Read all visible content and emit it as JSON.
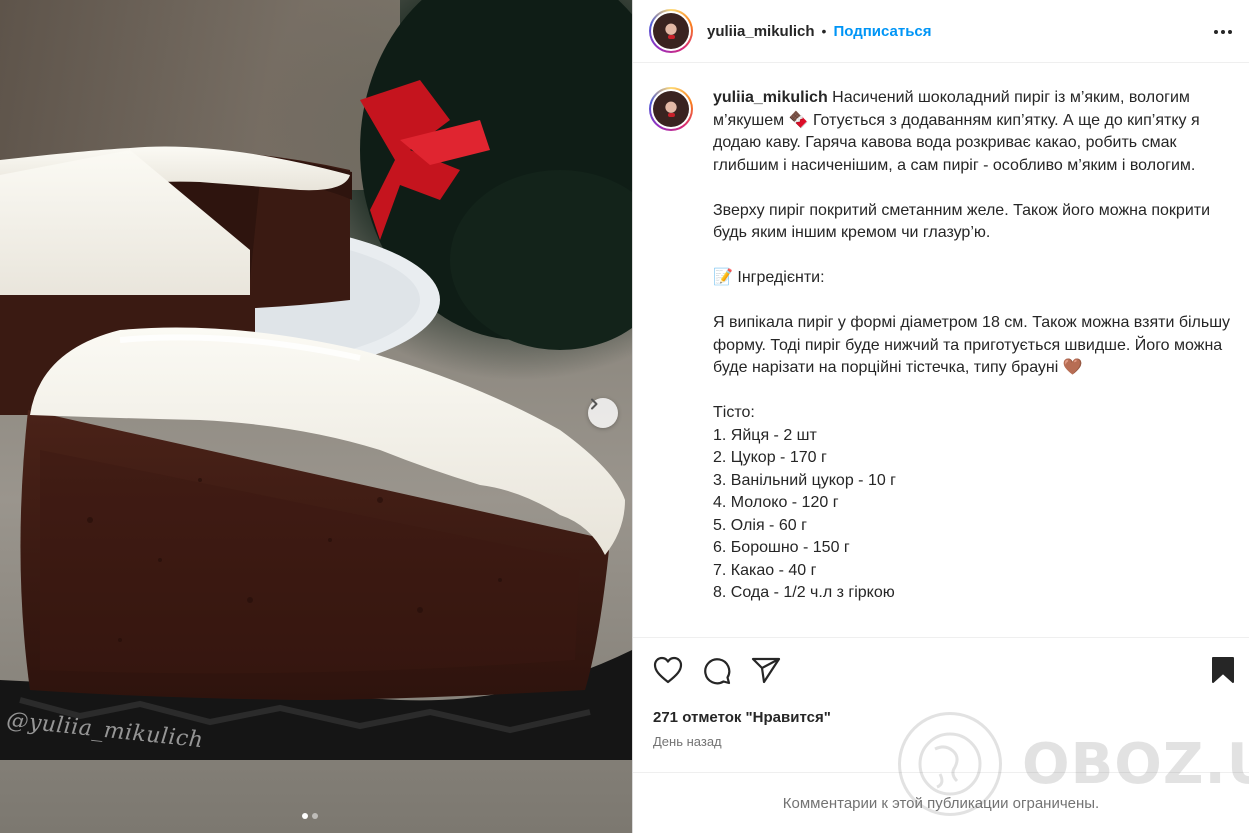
{
  "header": {
    "username": "yuliia_mikulich",
    "separator": "•",
    "follow_label": "Подписаться",
    "more_icon": "more-horizontal-icon"
  },
  "media": {
    "watermark": "@yuliia_mikulich",
    "next_icon": "chevron-right-icon",
    "slides_total": 2,
    "slide_current": 1
  },
  "caption": {
    "username": "yuliia_mikulich",
    "lines": [
      "Насичений шоколадний пиріг із м’яким, вологим м’якушем 🍫 Готується з додаванням кип’ятку. А ще до кип’ятку я додаю каву. Гаряча кавова вода розкриває какао, робить смак глибшим і насиченішим, а сам пиріг - особливо м’яким і вологим.",
      "",
      "Зверху пиріг покритий сметанним желе. Також його можна покрити будь яким іншим кремом чи глазур’ю.",
      "",
      "📝 Інгредієнти:",
      "",
      "Я випікала пиріг у формі діаметром 18 см. Також можна взяти більшу форму. Тоді пиріг буде нижчий та приготується швидше. Його можна буде нарізати на порційні тістечка, типу брауні 🤎",
      "",
      "Тісто:",
      "1. Яйця - 2 шт",
      "2. Цукор - 170 г",
      "3. Ванільний цукор - 10 г",
      "4. Молоко - 120 г",
      "5. Олія - 60 г",
      "6. Борошно - 150 г",
      "7. Какао - 40 г",
      "8. Сода - 1/2 ч.л з гіркою"
    ]
  },
  "actions": {
    "like_icon": "heart-icon",
    "comment_icon": "comment-icon",
    "share_icon": "send-icon",
    "save_icon": "bookmark-icon",
    "likes_text": "271 отметок \"Нравится\"",
    "time_text": "День назад"
  },
  "comments_notice": "Комментарии к этой публикации ограничены.",
  "overlay_watermark": "OBOZ.UA"
}
